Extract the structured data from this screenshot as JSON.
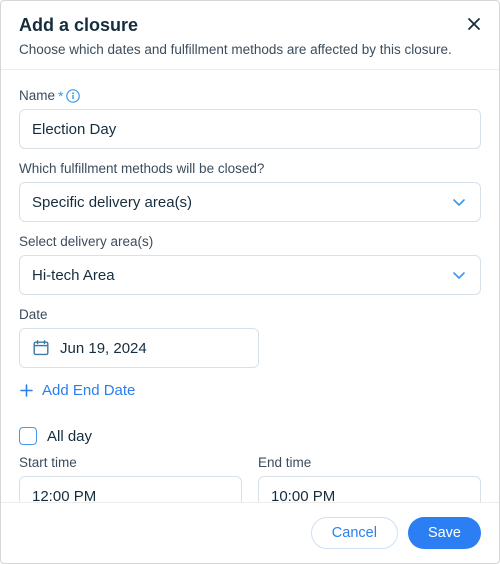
{
  "header": {
    "title": "Add a closure",
    "subtitle": "Choose which dates and fulfillment methods are affected by this closure."
  },
  "fields": {
    "name_label": "Name",
    "name_value": "Election Day",
    "methods_label": "Which fulfillment methods will be closed?",
    "methods_value": "Specific delivery area(s)",
    "areas_label": "Select delivery area(s)",
    "areas_value": "Hi-tech Area",
    "date_label": "Date",
    "date_value": "Jun 19, 2024",
    "add_end_date": "Add End Date",
    "all_day_label": "All day",
    "start_label": "Start time",
    "start_value": "12:00 PM",
    "end_label": "End time",
    "end_value": "10:00 PM"
  },
  "footer": {
    "cancel": "Cancel",
    "save": "Save"
  }
}
